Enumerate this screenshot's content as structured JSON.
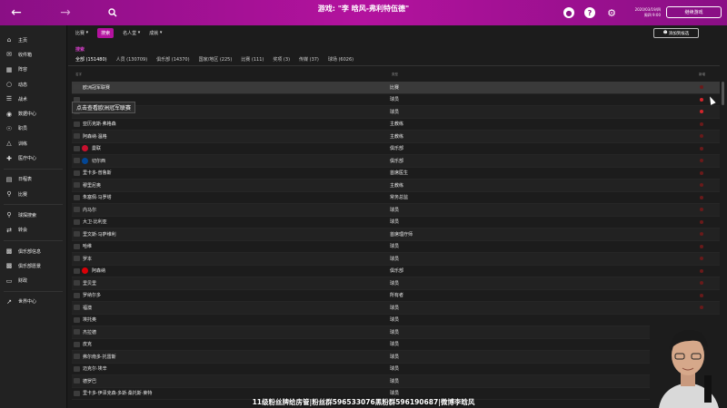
{
  "topbar": {
    "title": "游戏: \"李 晗风-弗利特伍德\"",
    "date_line1": "2020/03/19/四",
    "date_line2": "周四 9:00",
    "continue_label": "继续游戏"
  },
  "sidebar": {
    "items": [
      {
        "label": "主页",
        "icon": "home-icon"
      },
      {
        "label": "收件箱",
        "icon": "mail-icon"
      },
      {
        "label": "阵容",
        "icon": "squad-icon"
      },
      {
        "label": "动态",
        "icon": "dynamics-icon"
      },
      {
        "label": "战术",
        "icon": "tactics-icon"
      },
      {
        "label": "数据中心",
        "icon": "data-icon"
      },
      {
        "label": "职员",
        "icon": "staff-icon"
      },
      {
        "label": "训练",
        "icon": "training-icon"
      },
      {
        "label": "医疗中心",
        "icon": "medical-icon"
      },
      {
        "label": "日程表",
        "icon": "calendar-icon"
      },
      {
        "label": "比赛",
        "icon": "trophy-icon"
      },
      {
        "label": "球探搜索",
        "icon": "scout-icon"
      },
      {
        "label": "转会",
        "icon": "transfer-icon"
      },
      {
        "label": "俱乐部信息",
        "icon": "club-info-icon"
      },
      {
        "label": "俱乐部愿景",
        "icon": "vision-icon"
      },
      {
        "label": "财政",
        "icon": "finance-icon"
      },
      {
        "label": "世界中心",
        "icon": "world-icon"
      }
    ]
  },
  "subnav": {
    "items": [
      "比赛",
      "搜索",
      "名人堂",
      "成就"
    ],
    "active_index": 1,
    "add_shortlist": "添加到候选"
  },
  "search_heading": "搜索",
  "filter_tabs": [
    "全部 (151480)",
    "人员 (130709)",
    "俱乐部 (14370)",
    "国家/地区 (225)",
    "比赛 (111)",
    "奖项 (3)",
    "传媒 (37)",
    "球场 (6026)"
  ],
  "columns": {
    "name": "名字",
    "type": "类型",
    "new": "新增"
  },
  "tooltip": "点击查看欧洲冠军联赛",
  "rows": [
    {
      "name": "欧洲冠军联赛",
      "type": "比赛",
      "hot": false,
      "badge": ""
    },
    {
      "name": "",
      "type": "球员",
      "hot": true,
      "badge": ""
    },
    {
      "name": "",
      "type": "球员",
      "hot": true,
      "badge": ""
    },
    {
      "name": "亚历克斯·弗格森",
      "type": "主教练",
      "hot": false,
      "badge": ""
    },
    {
      "name": "阿森纳·温格",
      "type": "主教练",
      "hot": false,
      "badge": ""
    },
    {
      "name": "曼联",
      "type": "俱乐部",
      "hot": false,
      "badge": "#c8102e"
    },
    {
      "name": "切尔西",
      "type": "俱乐部",
      "hot": false,
      "badge": "#034694"
    },
    {
      "name": "里卡多·普鲁斯",
      "type": "首席医生",
      "hot": false,
      "badge": ""
    },
    {
      "name": "穆里尼奥",
      "type": "主教练",
      "hot": false,
      "badge": ""
    },
    {
      "name": "朱塞佩·马罗塔",
      "type": "常务总监",
      "hot": false,
      "badge": ""
    },
    {
      "name": "内马尔",
      "type": "球员",
      "hot": false,
      "badge": ""
    },
    {
      "name": "大卫·比利亚",
      "type": "球员",
      "hot": false,
      "badge": ""
    },
    {
      "name": "里文斯·马萨维利",
      "type": "首席理疗师",
      "hot": false,
      "badge": ""
    },
    {
      "name": "哈维",
      "type": "球员",
      "hot": false,
      "badge": ""
    },
    {
      "name": "罗本",
      "type": "球员",
      "hot": false,
      "badge": ""
    },
    {
      "name": "阿森纳",
      "type": "俱乐部",
      "hot": false,
      "badge": "#db0007"
    },
    {
      "name": "里贝里",
      "type": "球员",
      "hot": false,
      "badge": ""
    },
    {
      "name": "罗纳尔多",
      "type": "所有者",
      "hot": false,
      "badge": ""
    },
    {
      "name": "福澳",
      "type": "球员",
      "hot": false,
      "badge": ""
    },
    {
      "name": "埃托奥",
      "type": "球员",
      "hot": false,
      "badge": ""
    },
    {
      "name": "杰拉德",
      "type": "球员",
      "hot": false,
      "badge": ""
    },
    {
      "name": "皮克",
      "type": "球员",
      "hot": false,
      "badge": ""
    },
    {
      "name": "弗尔南多·托雷斯",
      "type": "球员",
      "hot": false,
      "badge": ""
    },
    {
      "name": "迈克尔·埃辛",
      "type": "球员",
      "hot": false,
      "badge": ""
    },
    {
      "name": "德罗巴",
      "type": "球员",
      "hot": false,
      "badge": ""
    },
    {
      "name": "里卡多·伊泽克森·多斯·桑托斯·莱特",
      "type": "球员",
      "hot": false,
      "badge": ""
    }
  ],
  "caption": "11级粉丝牌给房管|粉丝群596533076黑粉群596190687|微博李晗风",
  "colors": {
    "accent": "#b3129e",
    "hot": "#d2262c"
  }
}
